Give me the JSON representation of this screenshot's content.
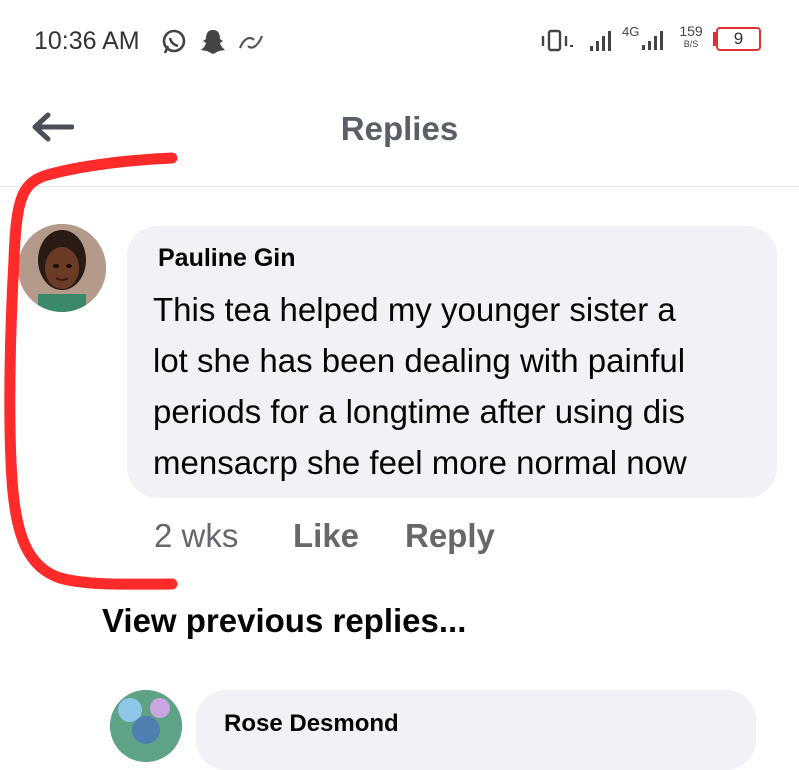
{
  "status_bar": {
    "time": "10:36 AM",
    "network_type": "4G",
    "data_speed": "159",
    "data_speed_unit": "B/S",
    "battery": "9",
    "icons": [
      "whatsapp-icon",
      "snapchat-icon",
      "link-icon",
      "vibrate-icon",
      "signal-icon",
      "signal-4g-icon",
      "battery-icon"
    ]
  },
  "header": {
    "title": "Replies",
    "back_icon": "back-arrow-icon"
  },
  "comment": {
    "author": "Pauline Gin",
    "lines": [
      "This tea helped my younger sister a",
      "lot she has been dealing with painful",
      "periods for a longtime after using dis",
      "mensacrp she feel more normal now"
    ],
    "time": "2 wks",
    "like_label": "Like",
    "reply_label": "Reply"
  },
  "view_previous": "View previous replies...",
  "next_comment": {
    "author": "Rose Desmond"
  },
  "colors": {
    "annotation": "#ff2a2a",
    "bubble": "#f0f2f5",
    "meta": "#65676b"
  }
}
